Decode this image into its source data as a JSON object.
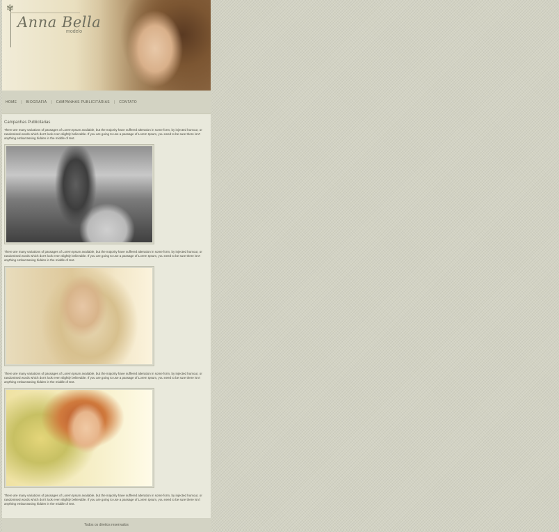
{
  "header": {
    "logo_name": "Anna Bella",
    "logo_sub": "modelo"
  },
  "nav": {
    "items": [
      "HOME",
      "BIOGRAFIA",
      "CAMPANHAS PUBLICITÁRIAS",
      "CONTATO"
    ],
    "separator": "|"
  },
  "content": {
    "section_title": "Campanhas Publicitarias",
    "paragraph": "There are many variations of passages of Lorem Ipsum available, but the majority have suffered alteration in some form, by injected humour, or randomised words which don't look even slightly believable. If you are going to use a passage of Lorem Ipsum, you need to be sure there isn't anything embarrassing hidden in the middle of text."
  },
  "footer": {
    "text": "Todos os direitos reservados"
  },
  "colors": {
    "background": "#d3d3c4",
    "content_bg": "#e9e9dc",
    "nav_bg": "#d3d3c3"
  }
}
